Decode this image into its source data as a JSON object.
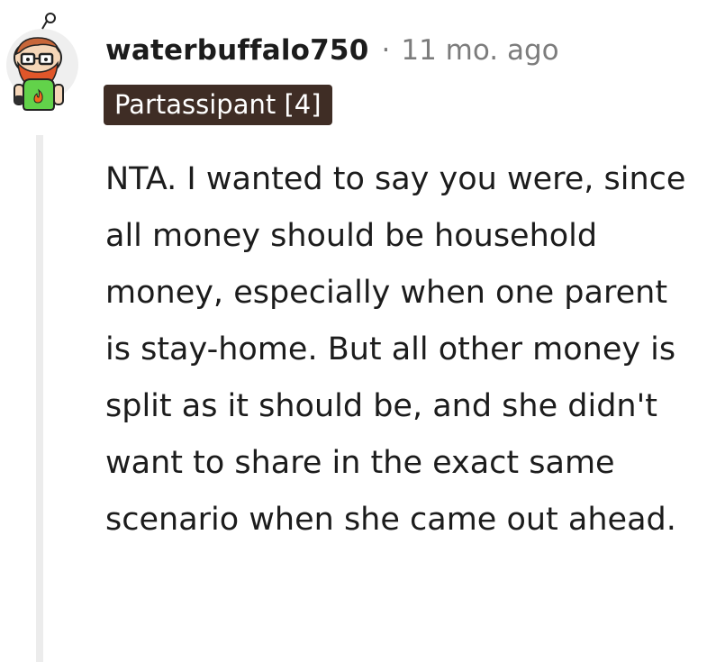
{
  "comment": {
    "author": "waterbuffalo750",
    "separator": "·",
    "timestamp": "11 mo. ago",
    "flair": "Partassipant [4]",
    "body": "NTA. I wanted to say you were, since all money should be household money, especially when one parent is stay-home. But all other money is split as it should be, and she didn't want to share in the exact same scenario when she came out ahead."
  },
  "colors": {
    "flair_background": "#3f2d25",
    "flair_text": "#ffffff",
    "author_text": "#1c1c1c",
    "meta_text": "#7c7c7c",
    "thread_line": "#ececec"
  },
  "icons": {
    "avatar": "snoo-avatar-icon"
  }
}
